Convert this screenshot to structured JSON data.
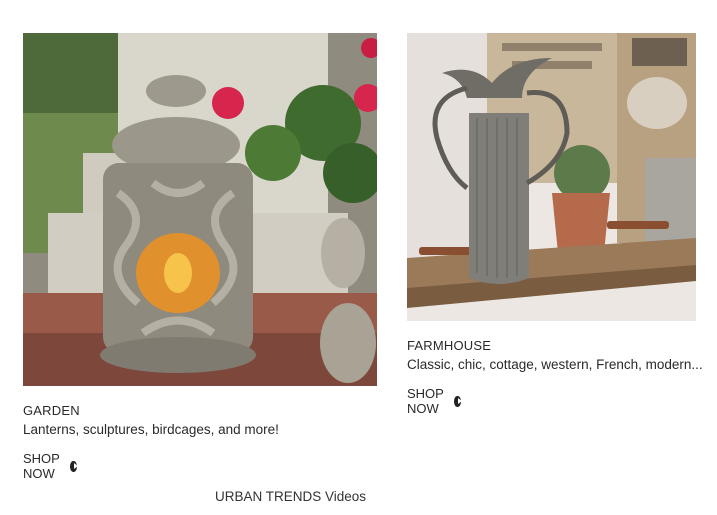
{
  "cards": [
    {
      "title": "GARDEN",
      "description": "Lanterns, sculptures, birdcages, and more!",
      "cta": "SHOP NOW",
      "image_alt": "stone bird lantern with candle and red geraniums"
    },
    {
      "title": "FARMHOUSE",
      "description": "Classic, chic, cottage, western, French, modern...",
      "cta": "SHOP NOW",
      "image_alt": "galvanized metal pitcher on wooden tray"
    }
  ],
  "footer": {
    "videos_link": "URBAN TRENDS Videos"
  },
  "icons": {
    "cta_icon": "play-circle-icon"
  }
}
